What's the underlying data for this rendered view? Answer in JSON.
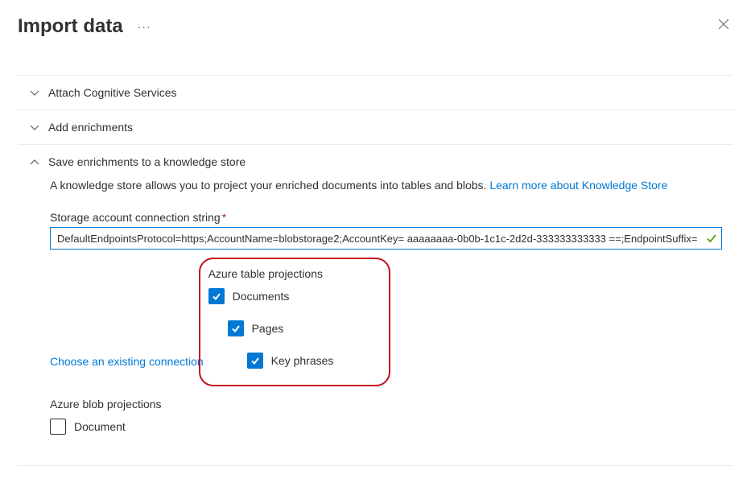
{
  "header": {
    "title": "Import data"
  },
  "accordion": {
    "attach_cognitive": "Attach Cognitive Services",
    "add_enrichments": "Add enrichments",
    "save_enrichments": "Save enrichments to a knowledge store"
  },
  "knowledge_store": {
    "intro_text": "A knowledge store allows you to project your enriched documents into tables and blobs. ",
    "intro_link": "Learn more about Knowledge Store",
    "conn_label": "Storage account connection string",
    "conn_value": "DefaultEndpointsProtocol=https;AccountName=blobstorage2;AccountKey= aaaaaaaa-0b0b-1c1c-2d2d-333333333333 ==;EndpointSuffix=",
    "choose_existing": "Choose an existing connection"
  },
  "table_projections": {
    "title": "Azure table projections",
    "documents": "Documents",
    "pages": "Pages",
    "key_phrases": "Key phrases"
  },
  "blob_projections": {
    "title": "Azure blob projections",
    "document": "Document"
  }
}
